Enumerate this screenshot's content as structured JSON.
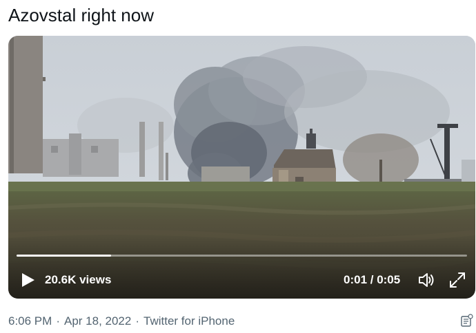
{
  "tweet": {
    "text": "Azovstal right now"
  },
  "video": {
    "views": "20.6K views",
    "time": "0:01 / 0:05",
    "progress": 0.21,
    "icons": {
      "play": "play-icon",
      "volume": "volume-icon",
      "fullscreen": "fullscreen-icon"
    }
  },
  "meta": {
    "time": "6:06 PM",
    "separator": "·",
    "date": "Apr 18, 2022",
    "source": "Twitter for iPhone",
    "analytics_icon": "analytics-icon"
  }
}
